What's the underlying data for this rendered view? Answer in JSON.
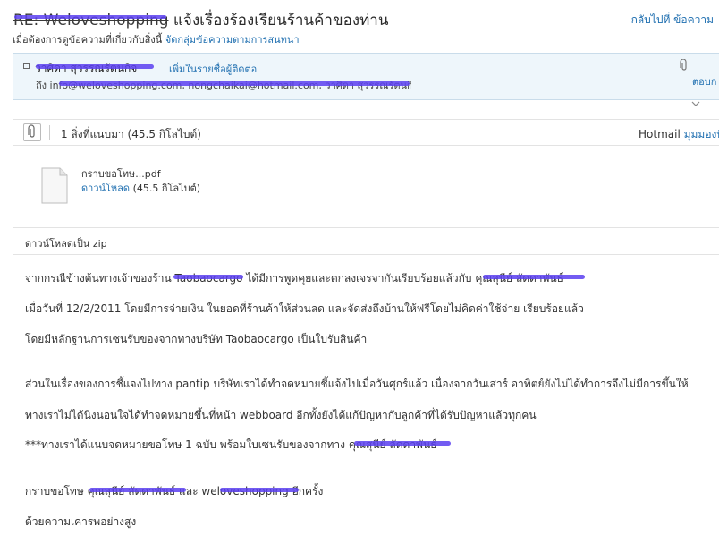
{
  "header": {
    "subject_prefix": "RE: Weloveshopping",
    "subject_rest": " แจ้งเรื่องร้องเรียนร้านค้าของท่าน",
    "back_link": "กลับไปที่ ข้อความ"
  },
  "subheader": {
    "text": "เมื่อต้องการดูข้อความที่เกี่ยวกับสิ่งนี้",
    "link": "จัดกลุ่มข้อความตามการสนทนา"
  },
  "sender": {
    "name": "วาศิดา สุวรรณรัตนกิจ",
    "add_contact": "เพิ่มในรายชื่อผู้ติดต่อ",
    "to_label": "ถึง",
    "to_value": "info@weloveshopping.com, nongchaikai@hotmail.com, วาศิดา สุวรรณรัตนกิจ",
    "reply_partial": "ตอบก"
  },
  "attachments": {
    "summary": "1 สิ่งที่แนบมา (45.5 กิโลไบต์)",
    "hotmail_label": "Hotmail",
    "view_link": "มุมมองที่",
    "file": {
      "name": "กราบขอโทษ...pdf",
      "download": "ดาวน์โหลด",
      "size": "(45.5 กิโลไบต์)"
    },
    "zip_label": "ดาวน์โหลดเป็น zip"
  },
  "message": {
    "line1_a": "จากกรณีข้างต้นทางเจ้าของร้าน T",
    "line1_b": "aobaocargo",
    "line1_c": " ได้มีการพูดคุยและตกลงเจรจากันเรียบร้อยแล้วกับ ",
    "line1_d": "คุณสุนีย์ ลัดดาพันธ์",
    "line2": "เมื่อวันที่ 12/2/2011 โดยมีการจ่ายเงิน ในยอดที่ร้านค้าให้ส่วนลด และจัดส่งถึงบ้านให้ฟรีโดยไม่คิดค่าใช้จ่าย เรียบร้อยแล้ว",
    "line3": "โดยมีหลักฐานการเซนรับของจากทางบริษัท Taobaocargo เป็นใบรับสินค้า",
    "line4": "ส่วนในเรื่องของการชี้แจงไปทาง pantip บริษัทเราได้ทำจดหมายชี้แจ้งไปเมื่อวันศุกร์แล้ว เนื่องจากวันเสาร์ อาทิตย์ยังไม่ได้ทำการจึงไม่มีการขึ้นให้",
    "line5": "ทางเราไม่ได้นิ่งนอนใจได้ทำจดหมายขึ้นที่หน้า webboard อีกทั้งยังได้แก้ปัญหากับลูกค้าที่ได้รับปัญหาแล้วทุกคน",
    "line6_a": "***ทางเราได้แนบจดหมายขอโทษ 1 ฉบับ พร้อมใบเซนรับของจากทาง ",
    "line6_b": "คุณสุนีย์ ลัดดาพันธ์",
    "line7_a": "กราบขอโทษ ",
    "line7_b": "คุณสุนีย์ ลัดดาพันธ์",
    "line7_c": " และ w",
    "line7_d": "eloveshopping",
    "line7_e": " อีกครั้ง",
    "line8": "ด้วยความเคารพอย่างสูง"
  }
}
